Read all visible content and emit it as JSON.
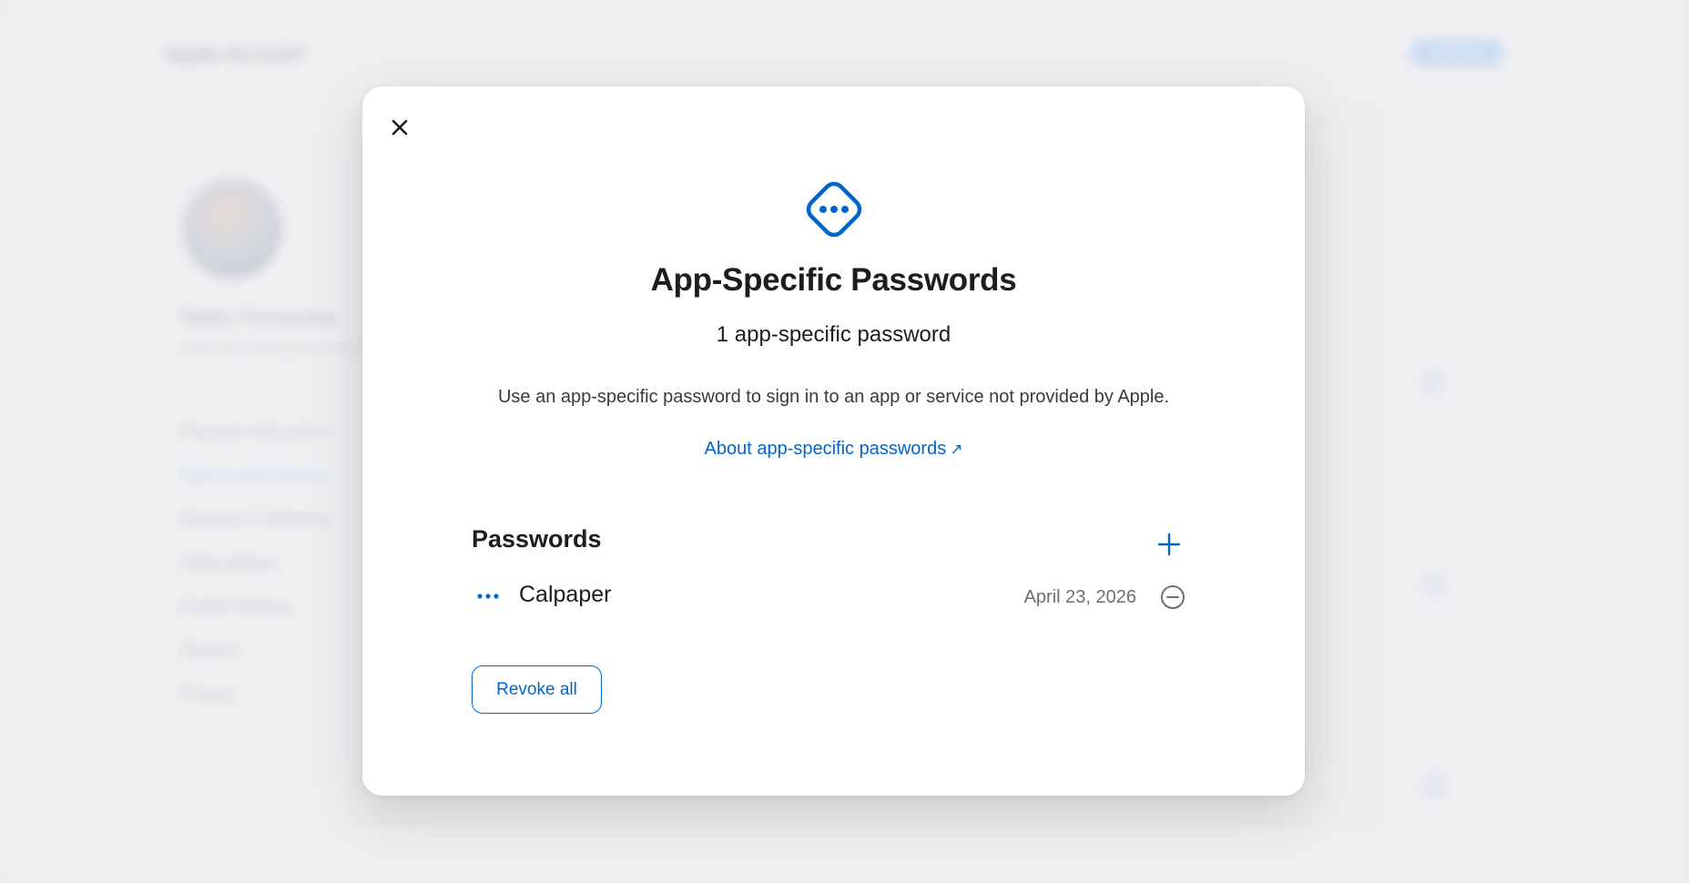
{
  "background": {
    "page_title": "Apple Account",
    "header_button": "Sign Out",
    "user_name": "Mattiu Fernandes",
    "user_email": "mattiu.fernandes@icloud.com",
    "nav_items": [
      "Personal Information",
      "Sign-In and Security",
      "Payment & Shipping",
      "Subscriptions",
      "Family Sharing",
      "Devices",
      "Privacy"
    ]
  },
  "modal": {
    "close_icon": "close-icon",
    "hero_icon": "password-diamond-icon",
    "title": "App-Specific Passwords",
    "count_text": "1 app-specific password",
    "description": "Use an app-specific password to sign in to an app or service not provided by Apple.",
    "about_link": "About app-specific passwords",
    "about_link_icon": "↗",
    "section_title": "Passwords",
    "add_icon": "plus-icon",
    "passwords": [
      {
        "name": "Calpaper",
        "date": "April 23, 2026",
        "icon": "ellipsis-icon",
        "remove_icon": "minus-circle-icon"
      }
    ],
    "revoke_all_label": "Revoke all"
  },
  "colors": {
    "accent": "#0066cc",
    "text_primary": "#1d1d1f",
    "text_secondary": "#6e6e73",
    "modal_bg": "#ffffff",
    "page_bg": "#ececef"
  }
}
